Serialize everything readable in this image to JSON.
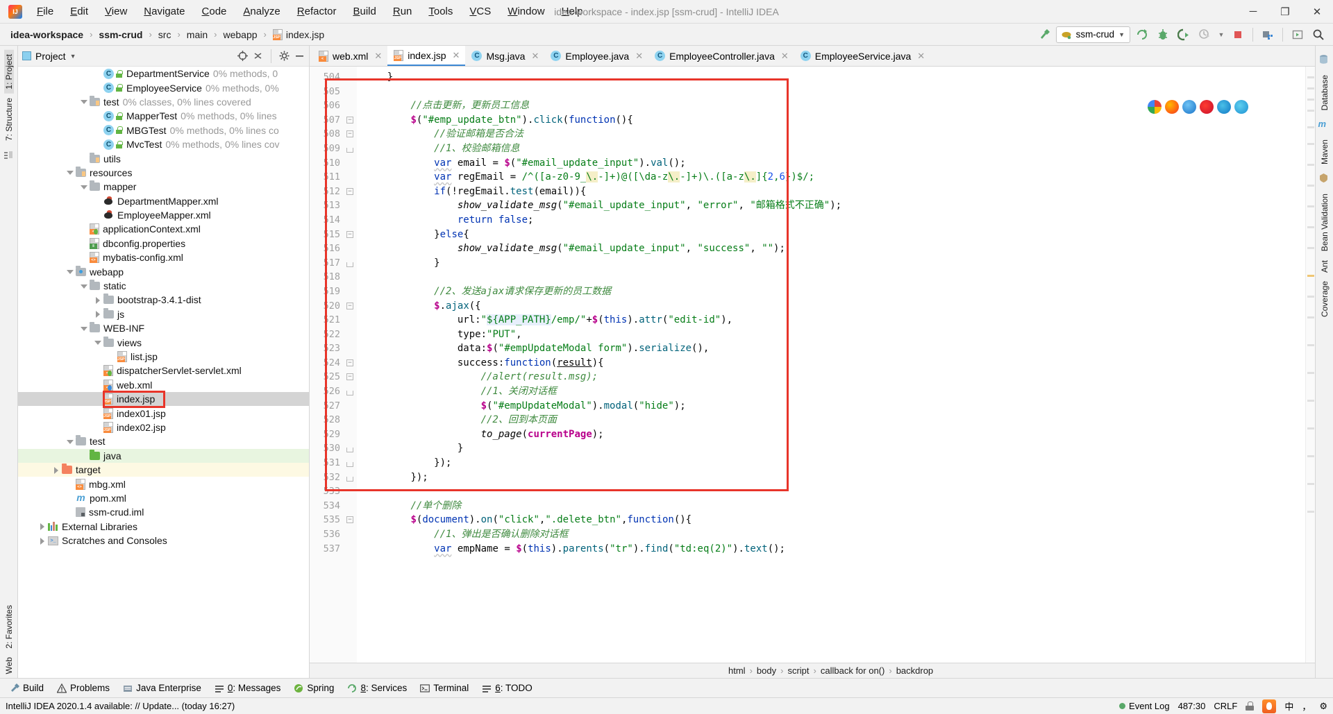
{
  "window": {
    "title": "idea-workspace - index.jsp [ssm-crud] - IntelliJ IDEA",
    "minimize": "─",
    "maximize": "❐",
    "close": "✕"
  },
  "menu": [
    "File",
    "Edit",
    "View",
    "Navigate",
    "Code",
    "Analyze",
    "Refactor",
    "Build",
    "Run",
    "Tools",
    "VCS",
    "Window",
    "Help"
  ],
  "breadcrumbs": [
    {
      "label": "idea-workspace",
      "bold": true
    },
    {
      "label": "ssm-crud",
      "bold": true
    },
    {
      "label": "src",
      "bold": false
    },
    {
      "label": "main",
      "bold": false
    },
    {
      "label": "webapp",
      "bold": false
    },
    {
      "label": "index.jsp",
      "bold": false,
      "icon": "jsp-file-icon"
    }
  ],
  "toolbar": {
    "run_config": "ssm-crud",
    "icons": [
      "build-hammer-icon",
      "run-icon",
      "debug-icon",
      "run-coverage-icon",
      "profiler-icon",
      "stop-icon",
      "update-app-icon",
      "run-anything-icon",
      "search-everywhere-icon"
    ]
  },
  "left_rail": {
    "top": [
      "1: Project",
      "7: Structure"
    ],
    "bottom": [
      "2: Favorites",
      "Web"
    ]
  },
  "right_rail": {
    "items": [
      "Database",
      "m",
      "Maven",
      "Bean Validation",
      "Ant",
      "Coverage"
    ]
  },
  "project_panel": {
    "title": "Project",
    "tree": [
      {
        "indent": 5,
        "type": "class",
        "label": "DepartmentService",
        "note": "0% methods, 0",
        "lock": true,
        "partial": true
      },
      {
        "indent": 5,
        "type": "class",
        "label": "EmployeeService",
        "note": "0% methods, 0%",
        "lock": true
      },
      {
        "indent": 4,
        "type": "folder-src",
        "label": "test",
        "note": "0% classes, 0% lines covered",
        "arrow": "down"
      },
      {
        "indent": 5,
        "type": "class-test",
        "label": "MapperTest",
        "note": "0% methods, 0% lines",
        "lock": true
      },
      {
        "indent": 5,
        "type": "class-test",
        "label": "MBGTest",
        "note": "0% methods, 0% lines co",
        "lock": true
      },
      {
        "indent": 5,
        "type": "class-test",
        "label": "MvcTest",
        "note": "0% methods, 0% lines cov",
        "lock": true
      },
      {
        "indent": 4,
        "type": "folder-src",
        "label": "utils",
        "note": ""
      },
      {
        "indent": 3,
        "type": "folder-res",
        "label": "resources",
        "note": "",
        "arrow": "down"
      },
      {
        "indent": 4,
        "type": "folder",
        "label": "mapper",
        "note": "",
        "arrow": "down"
      },
      {
        "indent": 5,
        "type": "mybatis",
        "label": "DepartmentMapper.xml",
        "note": ""
      },
      {
        "indent": 5,
        "type": "mybatis",
        "label": "EmployeeMapper.xml",
        "note": ""
      },
      {
        "indent": 4,
        "type": "xml-spring",
        "label": "applicationContext.xml",
        "note": ""
      },
      {
        "indent": 4,
        "type": "properties",
        "label": "dbconfig.properties",
        "note": ""
      },
      {
        "indent": 4,
        "type": "xml",
        "label": "mybatis-config.xml",
        "note": ""
      },
      {
        "indent": 3,
        "type": "folder-web",
        "label": "webapp",
        "note": "",
        "arrow": "down"
      },
      {
        "indent": 4,
        "type": "folder",
        "label": "static",
        "note": "",
        "arrow": "down"
      },
      {
        "indent": 5,
        "type": "folder",
        "label": "bootstrap-3.4.1-dist",
        "note": "",
        "arrow": "right"
      },
      {
        "indent": 5,
        "type": "folder",
        "label": "js",
        "note": "",
        "arrow": "right"
      },
      {
        "indent": 4,
        "type": "folder",
        "label": "WEB-INF",
        "note": "",
        "arrow": "down"
      },
      {
        "indent": 5,
        "type": "folder",
        "label": "views",
        "note": "",
        "arrow": "down"
      },
      {
        "indent": 6,
        "type": "jsp",
        "label": "list.jsp",
        "note": ""
      },
      {
        "indent": 5,
        "type": "xml-spring",
        "label": "dispatcherServlet-servlet.xml",
        "note": ""
      },
      {
        "indent": 5,
        "type": "xml-web",
        "label": "web.xml",
        "note": ""
      },
      {
        "indent": 5,
        "type": "jsp",
        "label": "index.jsp",
        "note": "",
        "selected": true,
        "highlighted": true
      },
      {
        "indent": 5,
        "type": "jsp",
        "label": "index01.jsp",
        "note": ""
      },
      {
        "indent": 5,
        "type": "jsp",
        "label": "index02.jsp",
        "note": ""
      },
      {
        "indent": 3,
        "type": "folder",
        "label": "test",
        "note": "",
        "arrow": "down"
      },
      {
        "indent": 4,
        "type": "folder-green",
        "label": "java",
        "note": "",
        "row": "green"
      },
      {
        "indent": 2,
        "type": "folder-orange",
        "label": "target",
        "note": "",
        "arrow": "right",
        "row": "yellow"
      },
      {
        "indent": 3,
        "type": "xml",
        "label": "mbg.xml",
        "note": ""
      },
      {
        "indent": 3,
        "type": "maven",
        "label": "pom.xml",
        "note": ""
      },
      {
        "indent": 3,
        "type": "iml",
        "label": "ssm-crud.iml",
        "note": ""
      },
      {
        "indent": 1,
        "type": "library",
        "label": "External Libraries",
        "note": "",
        "arrow": "right"
      },
      {
        "indent": 1,
        "type": "scratch",
        "label": "Scratches and Consoles",
        "note": "",
        "arrow": "right"
      }
    ]
  },
  "editor": {
    "tabs": [
      {
        "label": "web.xml",
        "icon": "xml-file-icon",
        "active": false
      },
      {
        "label": "index.jsp",
        "icon": "jsp-file-icon",
        "active": true
      },
      {
        "label": "Msg.java",
        "icon": "java-class-icon",
        "active": false
      },
      {
        "label": "Employee.java",
        "icon": "java-class-icon",
        "active": false
      },
      {
        "label": "EmployeeController.java",
        "icon": "java-class-icon",
        "active": false
      },
      {
        "label": "EmployeeService.java",
        "icon": "java-class-icon",
        "active": false
      }
    ],
    "first_line_number": 504,
    "lines": [
      {
        "n": 504,
        "fold": "",
        "html": "    <span class=\"c-pl\">}</span>"
      },
      {
        "n": 505,
        "fold": "",
        "html": ""
      },
      {
        "n": 506,
        "fold": "",
        "html": "        <span class=\"c-cmt\">//点击更新，更新员工信息</span>"
      },
      {
        "n": 507,
        "fold": "minus",
        "html": "        <span class=\"c-dollar\">$</span><span class=\"c-pl\">(</span><span class=\"c-str\">\"#emp_update_btn\"</span><span class=\"c-pl\">).</span><span class=\"c-fn\">click</span><span class=\"c-pl\">(</span><span class=\"c-kw\">function</span><span class=\"c-pl\">(){</span>"
      },
      {
        "n": 508,
        "fold": "minus",
        "html": "            <span class=\"c-cmt\">//验证邮箱是否合法</span>"
      },
      {
        "n": 509,
        "fold": "end",
        "html": "            <span class=\"c-cmt\">//1、校验邮箱信息</span>"
      },
      {
        "n": 510,
        "fold": "",
        "html": "            <span class=\"c-kw sq\">var</span> <span class=\"c-pl\">email = </span><span class=\"c-dollar\">$</span><span class=\"c-pl\">(</span><span class=\"c-str\">\"#email_update_input\"</span><span class=\"c-pl\">).</span><span class=\"c-fn\">val</span><span class=\"c-pl\">();</span>"
      },
      {
        "n": 511,
        "fold": "",
        "html": "            <span class=\"c-kw sq\">var</span> <span class=\"c-pl\">regEmail = </span><span class=\"c-re\">/^([a-z0-9_</span><span class=\"c-re hl\">\\.</span><span class=\"c-re\">-]+)@([\\da-z</span><span class=\"c-re hl\">\\.</span><span class=\"c-re\">-]+)\\.([a-z</span><span class=\"c-re hl\">\\.</span><span class=\"c-re\">]{</span><span class=\"c-num\">2</span><span class=\"c-re\">,</span><span class=\"c-num\">6</span><span class=\"c-re\">})$/;</span>"
      },
      {
        "n": 512,
        "fold": "minus",
        "html": "            <span class=\"c-kw\">if</span><span class=\"c-pl\">(!regEmail.</span><span class=\"c-fn\">test</span><span class=\"c-pl\">(email)){</span>"
      },
      {
        "n": 513,
        "fold": "",
        "html": "                <span class=\"c-ital\">show_validate_msg</span><span class=\"c-pl\">(</span><span class=\"c-str\">\"#email_update_input\"</span><span class=\"c-pl\">, </span><span class=\"c-str\">\"error\"</span><span class=\"c-pl\">, </span><span class=\"c-str\">\"邮箱格式不正确\"</span><span class=\"c-pl\">);</span>"
      },
      {
        "n": 514,
        "fold": "",
        "html": "                <span class=\"c-kw\">return</span> <span class=\"c-kw\">false</span><span class=\"c-pl\">;</span>"
      },
      {
        "n": 515,
        "fold": "minus",
        "html": "            <span class=\"c-pl\">}</span><span class=\"c-kw\">else</span><span class=\"c-pl\">{</span>"
      },
      {
        "n": 516,
        "fold": "",
        "html": "                <span class=\"c-ital\">show_validate_msg</span><span class=\"c-pl\">(</span><span class=\"c-str\">\"#email_update_input\"</span><span class=\"c-pl\">, </span><span class=\"c-str\">\"success\"</span><span class=\"c-pl\">, </span><span class=\"c-str\">\"\"</span><span class=\"c-pl\">);</span>"
      },
      {
        "n": 517,
        "fold": "end",
        "html": "            <span class=\"c-pl\">}</span>"
      },
      {
        "n": 518,
        "fold": "",
        "html": ""
      },
      {
        "n": 519,
        "fold": "",
        "html": "            <span class=\"c-cmt\">//2、发送ajax请求保存更新的员工数据</span>"
      },
      {
        "n": 520,
        "fold": "minus",
        "html": "            <span class=\"c-dollar\">$</span><span class=\"c-pl\">.</span><span class=\"c-fn\">ajax</span><span class=\"c-pl\">({</span>"
      },
      {
        "n": 521,
        "fold": "",
        "html": "                <span class=\"c-pl\">url:</span><span class=\"c-str\">\"</span><span class=\"c-str hl2\">${APP_PATH}</span><span class=\"c-str\">/emp/\"</span><span class=\"c-pl\">+</span><span class=\"c-dollar\">$</span><span class=\"c-pl\">(</span><span class=\"c-kw\">this</span><span class=\"c-pl\">).</span><span class=\"c-fn\">attr</span><span class=\"c-pl\">(</span><span class=\"c-str\">\"edit-id\"</span><span class=\"c-pl\">),</span>"
      },
      {
        "n": 522,
        "fold": "",
        "html": "                <span class=\"c-pl\">type:</span><span class=\"c-str\">\"PUT\"</span><span class=\"c-pl\">,</span>"
      },
      {
        "n": 523,
        "fold": "",
        "html": "                <span class=\"c-pl\">data:</span><span class=\"c-dollar\">$</span><span class=\"c-pl\">(</span><span class=\"c-str\">\"#empUpdateModal form\"</span><span class=\"c-pl\">).</span><span class=\"c-fn\">serialize</span><span class=\"c-pl\">(),</span>"
      },
      {
        "n": 524,
        "fold": "minus",
        "html": "                <span class=\"c-pl\">success:</span><span class=\"c-kw\">function</span><span class=\"c-pl\">(</span><span class=\"c-pl ul\">result</span><span class=\"c-pl\">){</span>"
      },
      {
        "n": 525,
        "fold": "minus",
        "html": "                    <span class=\"c-cmt\">//alert(result.msg);</span>"
      },
      {
        "n": 526,
        "fold": "end",
        "html": "                    <span class=\"c-cmt\">//1、关闭对话框</span>"
      },
      {
        "n": 527,
        "fold": "",
        "html": "                    <span class=\"c-dollar\">$</span><span class=\"c-pl\">(</span><span class=\"c-str\">\"#empUpdateModal\"</span><span class=\"c-pl\">).</span><span class=\"c-fn\">modal</span><span class=\"c-pl\">(</span><span class=\"c-str\">\"hide\"</span><span class=\"c-pl\">);</span>"
      },
      {
        "n": 528,
        "fold": "",
        "html": "                    <span class=\"c-cmt\">//2、回到本页面</span>"
      },
      {
        "n": 529,
        "fold": "",
        "html": "                    <span class=\"c-ital\">to_page</span><span class=\"c-pl\">(</span><span class=\"c-dollar\">currentPage</span><span class=\"c-pl\">);</span>"
      },
      {
        "n": 530,
        "fold": "end",
        "html": "                <span class=\"c-pl\">}</span>"
      },
      {
        "n": 531,
        "fold": "end",
        "html": "            <span class=\"c-pl\">});</span>"
      },
      {
        "n": 532,
        "fold": "end",
        "html": "        <span class=\"c-pl\">});</span>"
      },
      {
        "n": 533,
        "fold": "",
        "html": ""
      },
      {
        "n": 534,
        "fold": "",
        "html": "        <span class=\"c-cmt\">//单个删除</span>"
      },
      {
        "n": 535,
        "fold": "minus",
        "html": "        <span class=\"c-dollar\">$</span><span class=\"c-pl\">(</span><span class=\"c-kw\">document</span><span class=\"c-pl\">).</span><span class=\"c-fn\">on</span><span class=\"c-pl\">(</span><span class=\"c-str\">\"click\"</span><span class=\"c-pl\">,</span><span class=\"c-str\">\".delete_btn\"</span><span class=\"c-pl\">,</span><span class=\"c-kw\">function</span><span class=\"c-pl\">(){</span>"
      },
      {
        "n": 536,
        "fold": "",
        "html": "            <span class=\"c-cmt\">//1、弹出是否确认删除对话框</span>"
      },
      {
        "n": 537,
        "fold": "",
        "html": "            <span class=\"c-kw sq\">var</span> <span class=\"c-pl\">empName = </span><span class=\"c-dollar\">$</span><span class=\"c-pl\">(</span><span class=\"c-kw\">this</span><span class=\"c-pl\">).</span><span class=\"c-fn\">parents</span><span class=\"c-pl\">(</span><span class=\"c-str\">\"tr\"</span><span class=\"c-pl\">).</span><span class=\"c-fn\">find</span><span class=\"c-pl\">(</span><span class=\"c-str\">\"td:eq(2)\"</span><span class=\"c-pl\">).</span><span class=\"c-fn\">text</span><span class=\"c-pl\">();</span>"
      }
    ],
    "breadcrumb_path": [
      "html",
      "body",
      "script",
      "callback for on()",
      "backdrop"
    ],
    "browser_icons": [
      "chrome-icon",
      "firefox-icon",
      "explorer-icon",
      "opera-icon",
      "edge-legacy-icon",
      "edge-icon"
    ]
  },
  "bottom_tools": [
    {
      "label": "Build",
      "icon": "build-icon",
      "mnemonic": ""
    },
    {
      "label": "Problems",
      "icon": "warning-icon",
      "mnemonic": ""
    },
    {
      "label": "Java Enterprise",
      "icon": "java-enterprise-icon",
      "mnemonic": ""
    },
    {
      "label": "0: Messages",
      "icon": "messages-icon",
      "mnemonic": "0"
    },
    {
      "label": "Spring",
      "icon": "spring-icon",
      "mnemonic": ""
    },
    {
      "label": "8: Services",
      "icon": "services-icon",
      "mnemonic": "8"
    },
    {
      "label": "Terminal",
      "icon": "terminal-icon",
      "mnemonic": ""
    },
    {
      "label": "6: TODO",
      "icon": "todo-icon",
      "mnemonic": "6"
    }
  ],
  "status_bar": {
    "message": "IntelliJ IDEA 2020.1.4 available: // Update... (today 16:27)",
    "caret_position": "487:30",
    "line_separator": "CRLF",
    "event_log": "Event Log",
    "ime_lang": "中",
    "ime_punct": "，",
    "ime_misc": "⚙"
  },
  "colors": {
    "accent_blue": "#3c87d4",
    "redbox": "#e8352a",
    "green": "#62b543",
    "selection_gray": "#d4d4d4"
  }
}
